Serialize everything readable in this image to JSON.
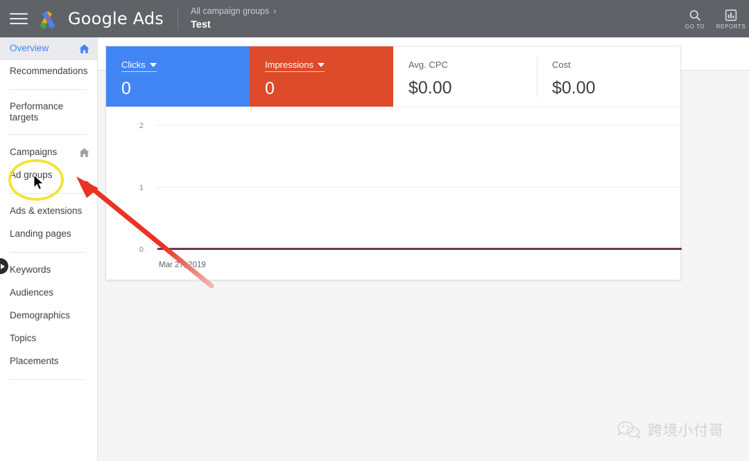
{
  "topbar": {
    "menu_icon": "hamburger-menu-icon",
    "logo_icon": "google-ads-logo-icon",
    "brand": "Google Ads",
    "breadcrumb_parent": "All campaign groups",
    "breadcrumb_chevron": "›",
    "breadcrumb_account": "Test",
    "actions": [
      {
        "icon": "search-icon",
        "label": "GO TO"
      },
      {
        "icon": "reports-bar-chart-icon",
        "label": "REPORTS"
      }
    ],
    "background": "#5f6368"
  },
  "sidebar": {
    "items": [
      {
        "label": "Overview",
        "selected": true,
        "home_icon": true,
        "home_color": "#4285f4"
      },
      {
        "label": "Recommendations",
        "selected": false,
        "home_icon": false
      },
      {
        "divider": true
      },
      {
        "label": "Performance targets",
        "selected": false,
        "home_icon": false,
        "two_line": true
      },
      {
        "divider": true
      },
      {
        "label": "Campaigns",
        "selected": false,
        "home_icon": true,
        "home_color": "#9aa0a6"
      },
      {
        "label": "Ad groups",
        "selected": false,
        "home_icon": false
      },
      {
        "divider": true
      },
      {
        "label": "Ads & extensions",
        "selected": false,
        "home_icon": false
      },
      {
        "label": "Landing pages",
        "selected": false,
        "home_icon": false
      },
      {
        "divider": true
      },
      {
        "label": "Keywords",
        "selected": false,
        "home_icon": false
      },
      {
        "label": "Audiences",
        "selected": false,
        "home_icon": false
      },
      {
        "label": "Demographics",
        "selected": false,
        "home_icon": false
      },
      {
        "label": "Topics",
        "selected": false,
        "home_icon": false
      },
      {
        "label": "Placements",
        "selected": false,
        "home_icon": false
      },
      {
        "divider": true
      }
    ],
    "collapse_handle_icon": "chevron-right-icon"
  },
  "page": {
    "title": "Overview"
  },
  "metrics": [
    {
      "label": "Clicks",
      "value": "0",
      "style": "blue",
      "has_dropdown": true,
      "color": "#4285f4"
    },
    {
      "label": "Impressions",
      "value": "0",
      "style": "orange",
      "has_dropdown": true,
      "color": "#dd4b2a"
    },
    {
      "label": "Avg. CPC",
      "value": "$0.00",
      "style": "plain",
      "has_dropdown": false
    },
    {
      "label": "Cost",
      "value": "$0.00",
      "style": "plain",
      "has_dropdown": false
    }
  ],
  "chart_data": {
    "type": "line",
    "title": "",
    "xlabel": "",
    "ylabel": "",
    "x": [
      "Mar 27, 2019"
    ],
    "categories": [
      "Mar 27, 2019"
    ],
    "series": [
      {
        "name": "Clicks",
        "values": [
          0
        ],
        "color": "#4285f4"
      },
      {
        "name": "Impressions",
        "values": [
          0
        ],
        "color": "#dd4b2a"
      }
    ],
    "y_ticks": [
      "0",
      "1",
      "2"
    ],
    "ylim": [
      0,
      2
    ],
    "x_tick_labels": [
      "Mar 27, 2019"
    ],
    "grid": true,
    "legend": "none",
    "line_color": "#6b2f48"
  },
  "annotations": {
    "circle": {
      "name": "highlight-circle",
      "color": "#f3e12a",
      "target": "Campaigns"
    },
    "arrow": {
      "name": "pointer-arrow",
      "color": "#ea3323",
      "points_to": "Campaigns home icon"
    },
    "cursor": {
      "name": "mouse-cursor",
      "over": "Campaigns"
    }
  },
  "watermark": {
    "icon": "wechat-logo-icon",
    "text": "跨境小付哥"
  }
}
